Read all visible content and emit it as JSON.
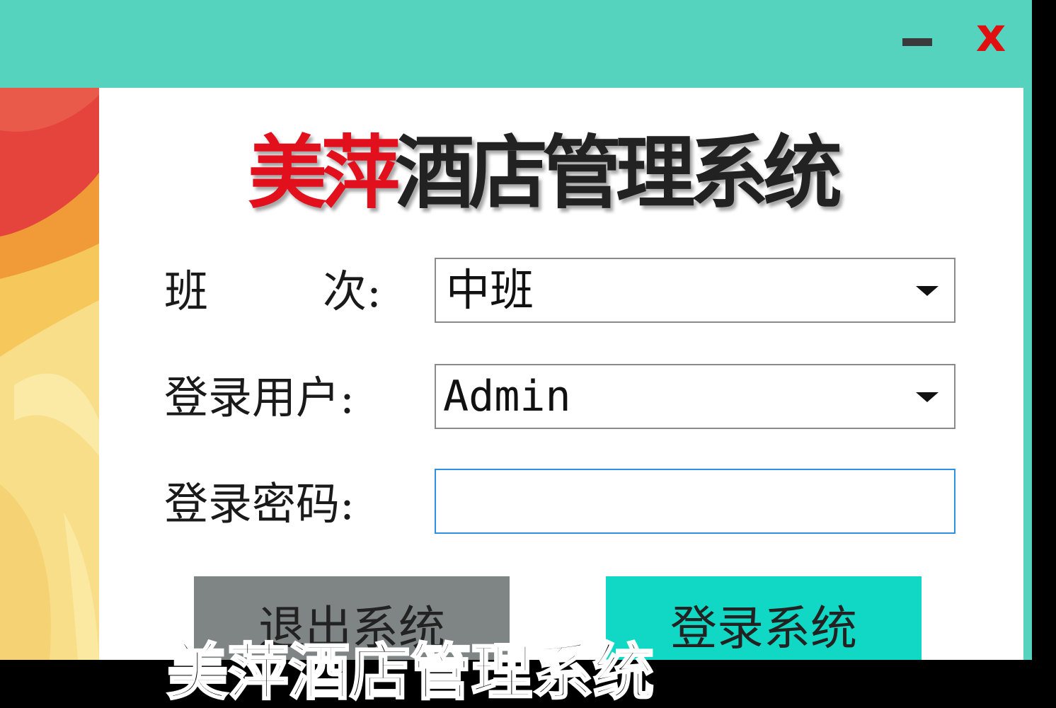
{
  "window": {
    "controls": {
      "minimize_icon": "minus-icon",
      "close_label": "x"
    }
  },
  "app": {
    "title_accent": "美萍",
    "title_rest": "酒店管理系统",
    "accent_color": "#e2101c",
    "titlebar_color": "#55d3be"
  },
  "form": {
    "shift_label_char1": "班",
    "shift_label_char2": "次:",
    "shift_value": "中班",
    "user_label": "登录用户:",
    "user_value": "Admin",
    "password_label": "登录密码:",
    "password_value": ""
  },
  "buttons": {
    "exit_label": "退出系统",
    "login_label": "登录系统"
  },
  "overlay": {
    "subtitle": "美萍酒店管理系统"
  }
}
